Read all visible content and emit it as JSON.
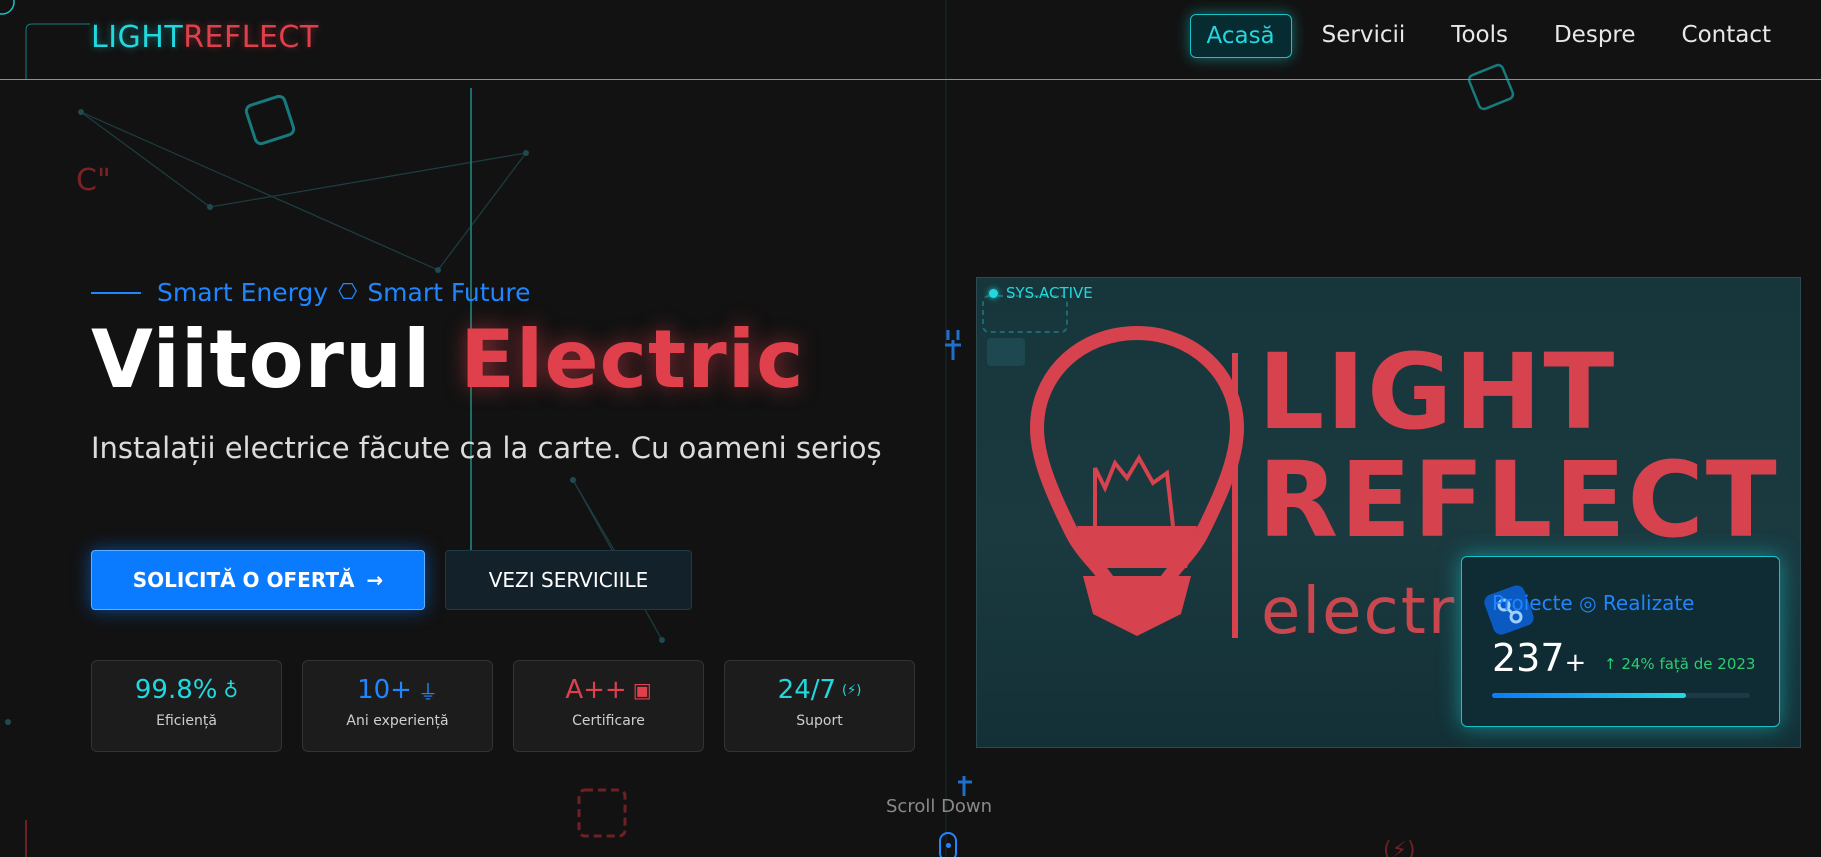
{
  "header": {
    "logo_part1": "LIGHT",
    "logo_part2": "REFLECT",
    "nav": [
      {
        "label": "Acasă",
        "active": true
      },
      {
        "label": "Servicii",
        "active": false
      },
      {
        "label": "Tools",
        "active": false
      },
      {
        "label": "Despre",
        "active": false
      },
      {
        "label": "Contact",
        "active": false
      }
    ]
  },
  "hero": {
    "tagline_part1": "Smart Energy",
    "tagline_separator_icon": "hexagon-icon",
    "tagline_part2": "Smart Future",
    "title_part1": "Viitorul",
    "title_part2": "Electric",
    "subtitle": "Instalații electrice făcute ca la carte. Cu oameni serioș",
    "cta_primary": "SOLICITĂ O OFERTĂ",
    "cta_primary_icon": "arrow-right-icon",
    "cta_secondary": "VEZI SERVICIILE"
  },
  "stats": [
    {
      "value": "99.8%",
      "label": "Eficiență",
      "icon": "lightbulb-icon",
      "color": "#22d8df"
    },
    {
      "value": "10+",
      "label": "Ani experiență",
      "icon": "plug-icon",
      "color": "#1f86ff"
    },
    {
      "value": "A++",
      "label": "Certificare",
      "icon": "certificate-icon",
      "color": "#e0404c"
    },
    {
      "value": "24/7",
      "label": "Suport",
      "icon": "charging-icon",
      "color": "#22d8df"
    }
  ],
  "scroll_label": "Scroll Down",
  "panel": {
    "status_badge": "SYS.ACTIVE",
    "brand_line1": "LIGHT",
    "brand_line2": "REFLECT",
    "brand_line3": "electric",
    "card": {
      "title": "Proiecte ◎ Realizate",
      "value": "237",
      "value_suffix": "+",
      "delta": "↑ 24% față de 2023",
      "progress": 0.75
    }
  },
  "colors": {
    "background": "#121212",
    "cyan_accent": "#22d8df",
    "red_accent": "#e0404c",
    "blue_accent": "#0a7bff"
  }
}
